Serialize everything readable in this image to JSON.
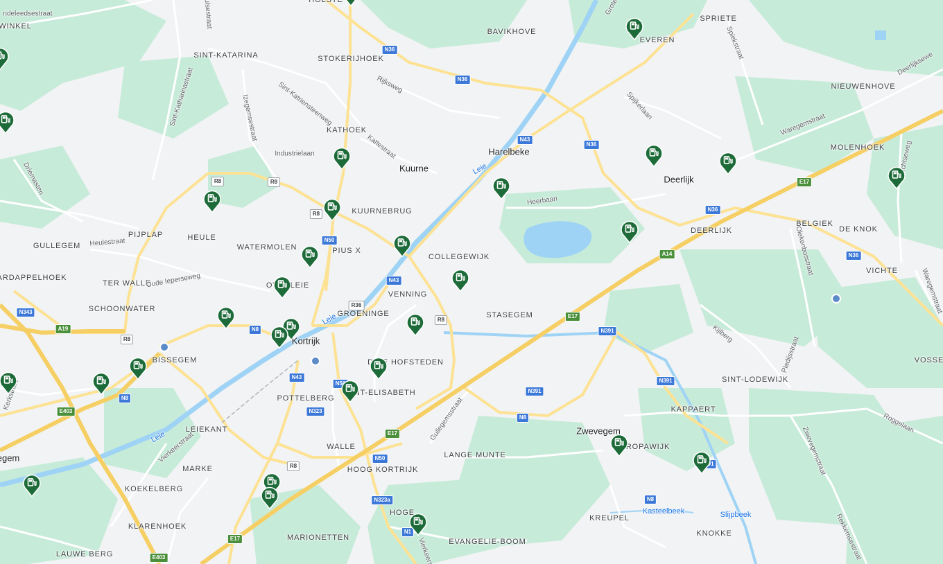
{
  "colors": {
    "land": "#f1f3f4",
    "green": "#c7ebd9",
    "water": "#9fd3f5",
    "motorway": "#f6cf64",
    "motorway_edge": "#e3b441",
    "major": "#fde293",
    "pin": "#1e6b3a"
  },
  "labels": {
    "towns": [
      "Kuurne",
      "Harelbeke",
      "Deerlijk",
      "Kortrijk",
      "Zwevegem",
      "egem"
    ],
    "hoods": [
      "STOKERIJHOEK",
      "SINT-KATARINA",
      "KATHOEK",
      "KUURNEBRUG",
      "BAVIKHOVE",
      "SPRIETE",
      "NIEUWENHOVE",
      "MOLENHOEK",
      "DEERLIJK",
      "BELGIEK",
      "DE KNOK",
      "VICHTE",
      "PIJPLAP",
      "GULLEGEM",
      "HEULE",
      "WATERMOLEN",
      "PIUS X",
      "COLLEGEWIJK",
      "ARDAPPELHOEK",
      "TER WALLE",
      "OVERLEIE",
      "VENNING",
      "SCHOONWATER",
      "GROENINGE",
      "STASEGEM",
      "BISSEGEM",
      "DRIE HOFSTEDEN",
      "POTTELBERG",
      "SINT-ELISABETH",
      "SINT-LODEWIJK",
      "VOSSE",
      "KAPPAERT",
      "LEIEKANT",
      "WALLE",
      "EUROPAWIJK",
      "LANGE MUNTE",
      "MARKE",
      "HOOG KORTRIJK",
      "KOEKELBERG",
      "HOGE",
      "KREUPEL",
      "KLARENHOEK",
      "MARIONETTEN",
      "EVANGELIE-BOOM",
      "LAUWE BERG",
      "KNOKKE",
      "WINKEL",
      "HOLSTE",
      "EVEREN"
    ],
    "streets": [
      "ndeleedsestraat",
      "ulsestraat",
      "Sint-Katharinastraat",
      "Sint-Katriensteenweg",
      "Izegemsestraat",
      "Rijksweg",
      "Grote",
      "Spiekstraat",
      "Spijkerlaan",
      "Deerlijksewe",
      "Industrielaan",
      "Kattestraat",
      "Driemasten",
      "Heerbaan",
      "Waregemstraat",
      "Vichtseweg",
      "Heulestraat",
      "Oude Ieperseweg",
      "Olekenbosstraat",
      "Waregemstraat",
      "Kijlberg",
      "Pladijsstraat",
      "Kerkstraat",
      "Gullegemsstraat",
      "Roggelaan",
      "Zwevegemstraat",
      "Vierkeerstraat",
      "Rekkemsestraat",
      "Vierkeerstraat",
      "Do"
    ],
    "water": [
      "Leie",
      "Leie",
      "Leie",
      "Kasteelbeek",
      "Slijpbeek"
    ]
  },
  "shields": [
    "N36",
    "N36",
    "N36",
    "N36",
    "N36",
    "N43",
    "N43",
    "N43",
    "R8",
    "R8",
    "R8",
    "R8",
    "R8",
    "R8",
    "N50",
    "N50",
    "N50",
    "R36",
    "N343",
    "A19",
    "N8",
    "N8",
    "N8",
    "N8",
    "E403",
    "E403",
    "E17",
    "E17",
    "E17",
    "E17",
    "A14",
    "N391",
    "N391",
    "N391",
    "N323",
    "N323a",
    "N1",
    "N391"
  ],
  "charging_stations_icon": "ev-charger-icon",
  "charging_stations_count": 28,
  "poi_icons": [
    "train-station-icon",
    "train-station-icon",
    "train-station-icon"
  ]
}
